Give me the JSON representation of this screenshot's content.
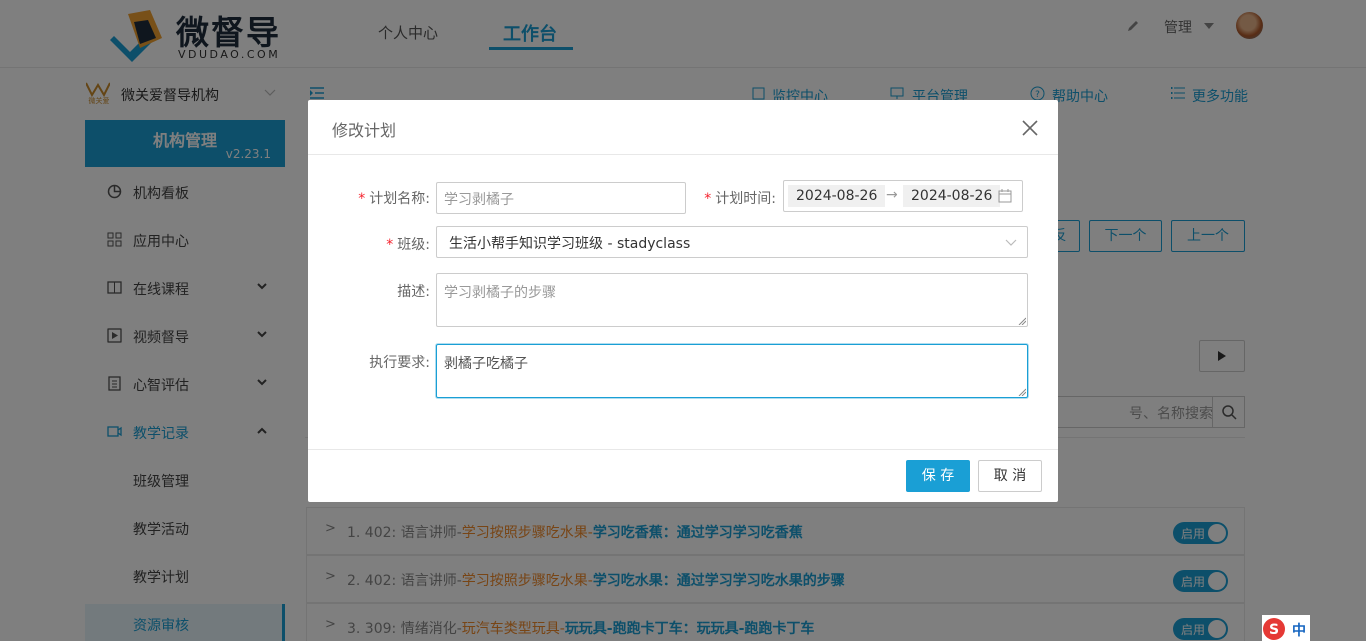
{
  "header": {
    "logo_title": "微督导",
    "logo_sub": "VDUDAO.COM",
    "nav": [
      "个人中心",
      "工作台"
    ],
    "user_menu": "管理"
  },
  "sidebar": {
    "org_name": "微关爱督导机构",
    "org_logo_text": "微关爱",
    "panel_title": "机构管理",
    "version": "v2.23.1",
    "items": [
      {
        "label": "机构看板"
      },
      {
        "label": "应用中心"
      },
      {
        "label": "在线课程"
      },
      {
        "label": "视频督导"
      },
      {
        "label": "心智评估"
      },
      {
        "label": "教学记录"
      }
    ],
    "sub_items": [
      "班级管理",
      "教学活动",
      "教学计划",
      "资源审核"
    ]
  },
  "content": {
    "top_links": [
      "监控中心",
      "平台管理",
      "帮助中心",
      "更多功能"
    ],
    "partial_button": "反",
    "next_button": "下一个",
    "prev_button": "上一个",
    "search_placeholder": "号、名称搜索",
    "toggle_label": "启用",
    "rows": [
      {
        "num": "1. 402: 语言讲师-",
        "category": "学习按照步骤吃水果-",
        "name": "学习吃香蕉：通过学习学习吃香蕉"
      },
      {
        "num": "2. 402: 语言讲师-",
        "category": "学习按照步骤吃水果-",
        "name": "学习吃水果：通过学习学习吃水果的步骤"
      },
      {
        "num": "3. 309: 情绪消化-",
        "category": "玩汽车类型玩具-",
        "name": "玩玩具-跑跑卡丁车：玩玩具-跑跑卡丁车"
      }
    ]
  },
  "modal": {
    "title": "修改计划",
    "plan_name_label": "计划名称:",
    "plan_name_value": "学习剥橘子",
    "plan_time_label": "计划时间:",
    "date_start": "2024-08-26",
    "date_end": "2024-08-26",
    "date_sep": "→",
    "class_label": "班级:",
    "class_value": "生活小帮手知识学习班级 - stadyclass",
    "desc_label": "描述:",
    "desc_value": "学习剥橘子的步骤",
    "req_label": "执行要求:",
    "req_value": "剥橘子吃橘子",
    "save": "保 存",
    "cancel": "取 消"
  },
  "ime": {
    "label": "中"
  },
  "colors": {
    "accent": "#1a9fd5",
    "orange": "#f08a2b",
    "required": "#f5222d"
  }
}
